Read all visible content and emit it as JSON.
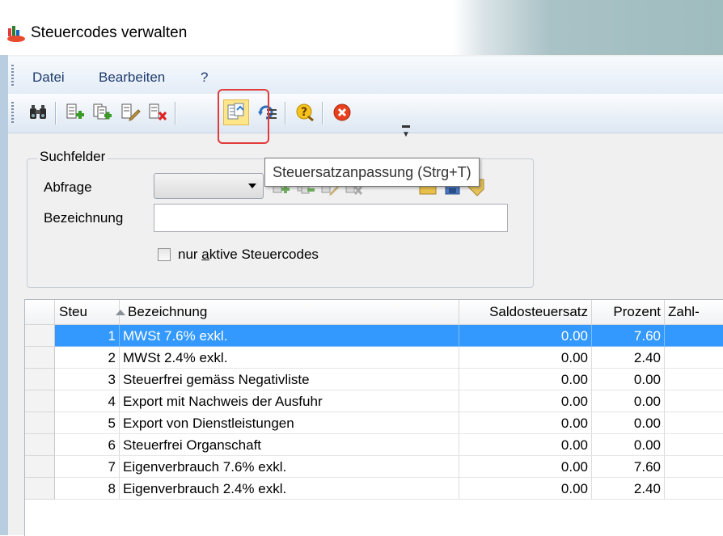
{
  "window": {
    "title": "Steuercodes verwalten"
  },
  "menu": {
    "items": [
      "Datei",
      "Bearbeiten",
      "?"
    ]
  },
  "toolbar": {
    "buttons": [
      "binoculars-icon",
      "add-record-icon",
      "copy-record-icon",
      "edit-record-icon",
      "delete-record-icon",
      "tax-rate-adjust-icon",
      "query-settings-icon",
      "help-icon",
      "close-icon"
    ],
    "tooltip": "Steuersatzanpassung (Strg+T)"
  },
  "search": {
    "group_title": "Suchfelder",
    "abfrage_label": "Abfrage",
    "abfrage_value": "",
    "bezeichnung_label": "Bezeichnung",
    "bezeichnung_value": "",
    "checkbox_label": "nur aktive Steuercodes",
    "checkbox_checked": false
  },
  "grid": {
    "columns": [
      "Steu",
      "Bezeichnung",
      "Saldosteuersatz",
      "Prozent",
      "Zahl-"
    ],
    "sorted_column": "Bezeichnung",
    "rows": [
      {
        "code": "1",
        "name": "MWSt 7.6% exkl.",
        "saldo": "0.00",
        "prozent": "7.60",
        "selected": true
      },
      {
        "code": "2",
        "name": "MWSt 2.4% exkl.",
        "saldo": "0.00",
        "prozent": "2.40"
      },
      {
        "code": "3",
        "name": "Steuerfrei gemäss Negativliste",
        "saldo": "0.00",
        "prozent": "0.00"
      },
      {
        "code": "4",
        "name": "Export mit Nachweis der Ausfuhr",
        "saldo": "0.00",
        "prozent": "0.00"
      },
      {
        "code": "5",
        "name": "Export von Dienstleistungen",
        "saldo": "0.00",
        "prozent": "0.00"
      },
      {
        "code": "6",
        "name": "Steuerfrei Organschaft",
        "saldo": "0.00",
        "prozent": "0.00"
      },
      {
        "code": "7",
        "name": "Eigenverbrauch 7.6% exkl.",
        "saldo": "0.00",
        "prozent": "7.60"
      },
      {
        "code": "8",
        "name": "Eigenverbrauch 2.4% exkl.",
        "saldo": "0.00",
        "prozent": "2.40"
      }
    ]
  },
  "colors": {
    "selection": "#3399ff",
    "highlight_box": "#e23b3b",
    "menu_text": "#1f3c6e"
  }
}
